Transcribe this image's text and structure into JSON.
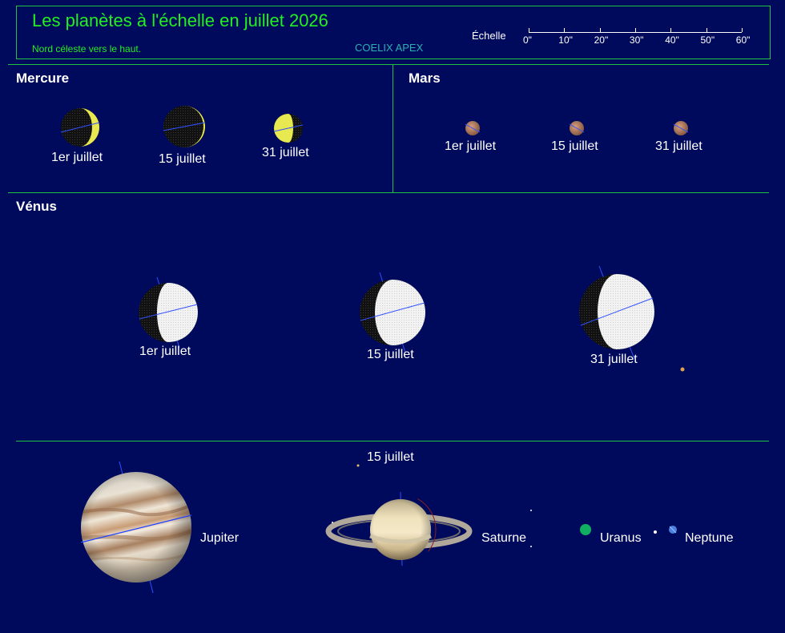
{
  "header": {
    "title": "Les planètes à l'échelle en juillet 2026",
    "subtitle": "Nord céleste vers le haut.",
    "credit": "COELIX APEX",
    "scale_label": "Échelle",
    "scale_ticks": [
      "0\"",
      "10\"",
      "20\"",
      "30\"",
      "40\"",
      "50\"",
      "60\""
    ]
  },
  "sections": {
    "mercury": "Mercure",
    "mars": "Mars",
    "venus": "Vénus"
  },
  "dates": {
    "d1": "1er juillet",
    "d15": "15 juillet",
    "d31": "31 juillet"
  },
  "outer": {
    "date": "15 juillet",
    "jupiter": "Jupiter",
    "saturn": "Saturne",
    "uranus": "Uranus",
    "neptune": "Neptune"
  },
  "colors": {
    "background": "#000a5c",
    "frame": "#20c040",
    "title": "#22ee22",
    "credit": "#2ab0b0",
    "mercury_lit": "#e8e850",
    "venus_lit": "#f0f0f0",
    "mars": "#c08a6a",
    "uranus": "#10b060",
    "neptune": "#4a80e0"
  }
}
